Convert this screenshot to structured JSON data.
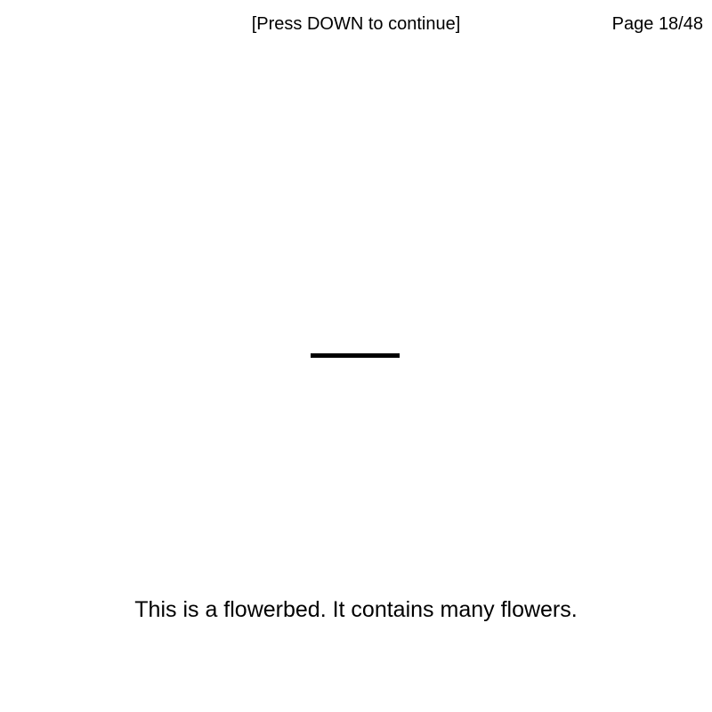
{
  "prompt": "[Press DOWN to continue]",
  "page": {
    "label": "Page 18/48",
    "current": 18,
    "total": 48
  },
  "caption": "This is a flowerbed. It contains many flowers.",
  "colors": {
    "background": "#ffffff",
    "foreground": "#000000"
  }
}
